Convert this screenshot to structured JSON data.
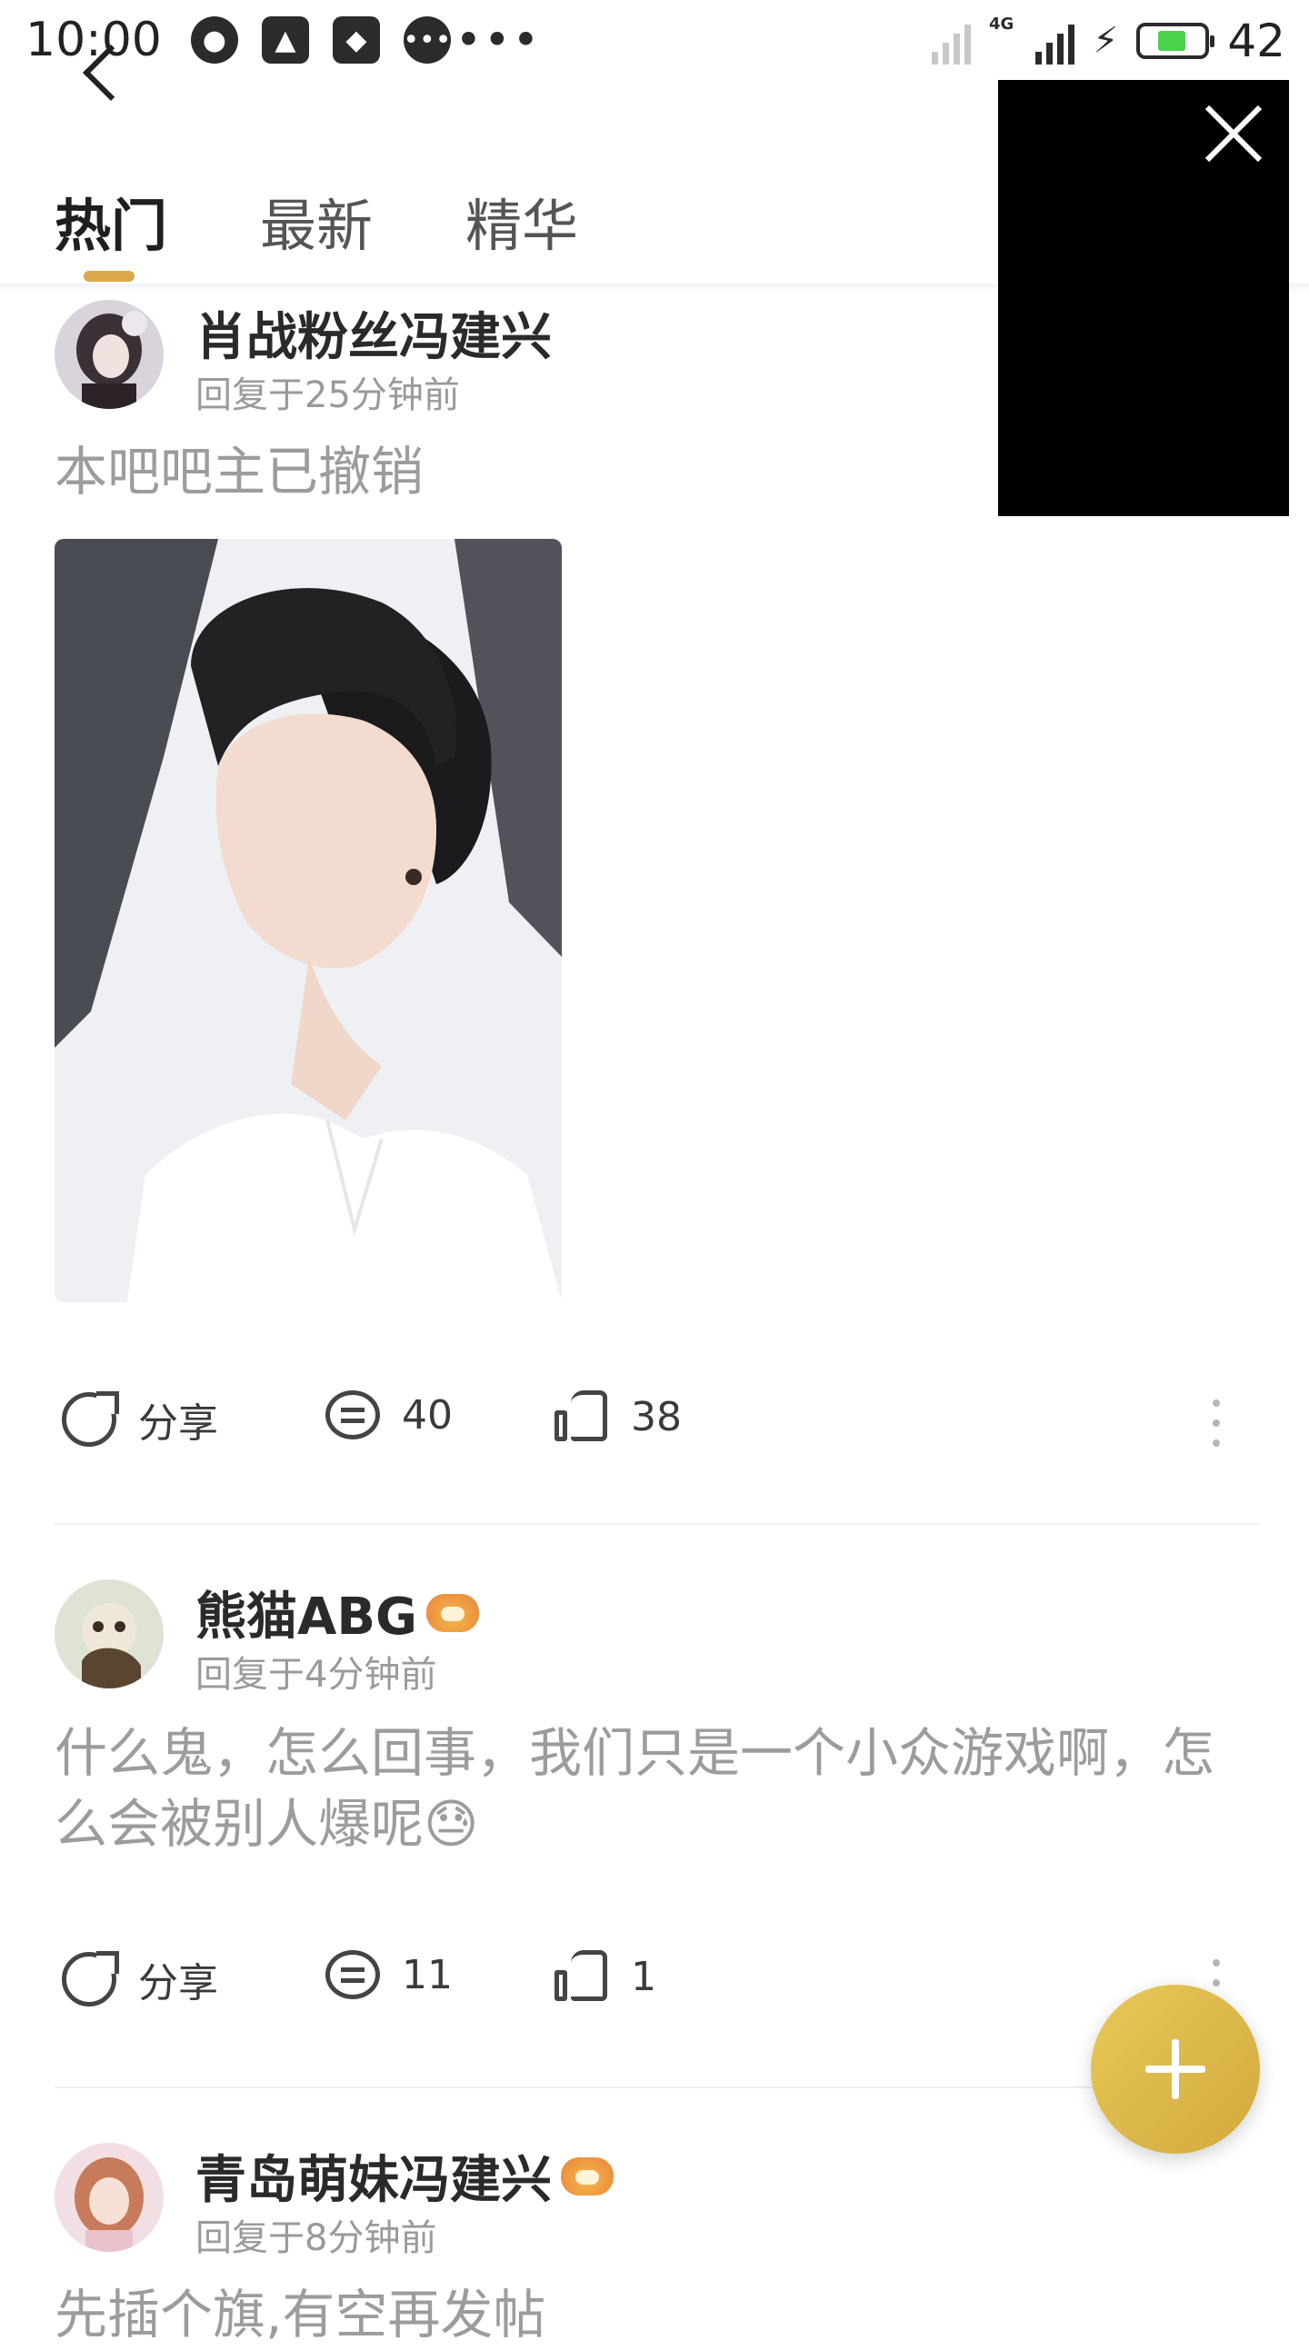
{
  "status_bar": {
    "time": "10:00",
    "network": "4G",
    "battery": "42"
  },
  "tabs": [
    {
      "label": "热门",
      "active": true
    },
    {
      "label": "最新",
      "active": false
    },
    {
      "label": "精华",
      "active": false
    }
  ],
  "posts": [
    {
      "username": "肖战粉丝冯建兴",
      "timestamp": "回复于25分钟前",
      "content": "本吧吧主已撤销",
      "has_image": true,
      "share_label": "分享",
      "comments": "40",
      "likes": "38"
    },
    {
      "username": "熊猫ABG",
      "timestamp": "回复于4分钟前",
      "content": "什么鬼，怎么回事，我们只是一个小众游戏啊，怎么会被别人爆呢😓",
      "has_badge": true,
      "share_label": "分享",
      "comments": "11",
      "likes": "1"
    },
    {
      "username": "青岛萌妹冯建兴",
      "timestamp": "回复于8分钟前",
      "content": "先插个旗,有空再发帖",
      "has_badge": true
    }
  ],
  "icons": {
    "fab": "plus-icon",
    "overlay_close": "close-icon",
    "share": "share-icon",
    "comment": "comment-icon",
    "like": "thumbs-up-icon",
    "more": "more-vertical-icon"
  },
  "colors": {
    "accent": "#d9a84a",
    "fab": "#d9b24a",
    "text_muted": "#9c9c9c"
  }
}
